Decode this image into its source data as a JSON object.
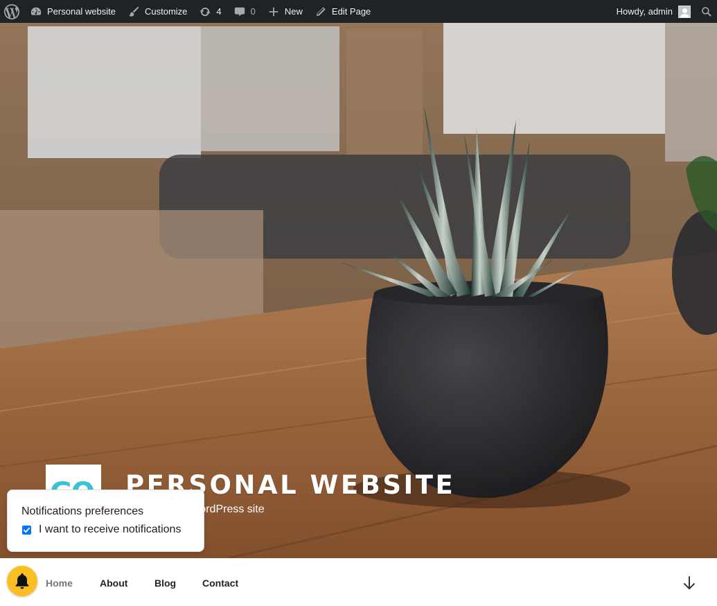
{
  "adminbar": {
    "site_name": "Personal website",
    "customize": "Customize",
    "updates_count": "4",
    "comments_count": "0",
    "new": "New",
    "edit_page": "Edit Page",
    "howdy": "Howdy, admin"
  },
  "hero": {
    "title": "Personal Website",
    "description": "Just another WordPress site",
    "logo_text": "GO"
  },
  "notifications": {
    "title": "Notifications preferences",
    "option_label": "I want to receive notifications",
    "checked": true
  },
  "nav": {
    "items": [
      {
        "label": "Home",
        "active": true
      },
      {
        "label": "About"
      },
      {
        "label": "Blog"
      },
      {
        "label": "Contact"
      }
    ]
  },
  "colors": {
    "adminbar_bg": "#1d2327",
    "checkbox": "#0075ff",
    "bell": "#fbbf24"
  }
}
